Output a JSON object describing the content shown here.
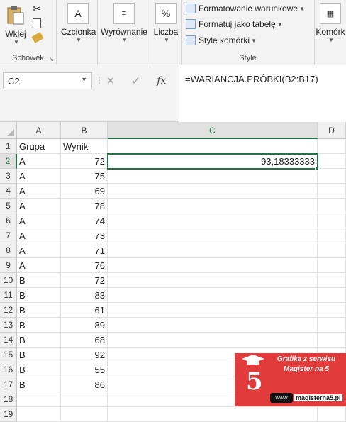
{
  "ribbon": {
    "clipboard": {
      "paste_label": "Wklej",
      "group_label": "Schowek"
    },
    "font": {
      "label": "Czcionka"
    },
    "alignment": {
      "label": "Wyrównanie"
    },
    "number": {
      "label": "Liczba",
      "icon_text": "%"
    },
    "styles": {
      "conditional_formatting": "Formatowanie warunkowe",
      "format_as_table": "Formatuj jako tabelę",
      "cell_styles": "Style komórki",
      "group_label": "Style"
    },
    "cells": {
      "label": "Komórk"
    }
  },
  "formula_bar": {
    "name_box": "C2",
    "cancel": "✕",
    "enter": "✓",
    "fx": "fx",
    "formula": "=WARIANCJA.PRÓBKI(B2:B17)"
  },
  "sheet": {
    "columns": [
      "A",
      "B",
      "C",
      "D"
    ],
    "rows": [
      {
        "n": "1",
        "a": "Grupa",
        "b": "Wynik",
        "c": ""
      },
      {
        "n": "2",
        "a": "A",
        "b": "72",
        "c": "93,18333333"
      },
      {
        "n": "3",
        "a": "A",
        "b": "75",
        "c": ""
      },
      {
        "n": "4",
        "a": "A",
        "b": "69",
        "c": ""
      },
      {
        "n": "5",
        "a": "A",
        "b": "78",
        "c": ""
      },
      {
        "n": "6",
        "a": "A",
        "b": "74",
        "c": ""
      },
      {
        "n": "7",
        "a": "A",
        "b": "73",
        "c": ""
      },
      {
        "n": "8",
        "a": "A",
        "b": "71",
        "c": ""
      },
      {
        "n": "9",
        "a": "A",
        "b": "76",
        "c": ""
      },
      {
        "n": "10",
        "a": "B",
        "b": "72",
        "c": ""
      },
      {
        "n": "11",
        "a": "B",
        "b": "83",
        "c": ""
      },
      {
        "n": "12",
        "a": "B",
        "b": "61",
        "c": ""
      },
      {
        "n": "13",
        "a": "B",
        "b": "89",
        "c": ""
      },
      {
        "n": "14",
        "a": "B",
        "b": "68",
        "c": ""
      },
      {
        "n": "15",
        "a": "B",
        "b": "92",
        "c": ""
      },
      {
        "n": "16",
        "a": "B",
        "b": "55",
        "c": ""
      },
      {
        "n": "17",
        "a": "B",
        "b": "86",
        "c": ""
      },
      {
        "n": "18",
        "a": "",
        "b": "",
        "c": ""
      },
      {
        "n": "19",
        "a": "",
        "b": "",
        "c": ""
      }
    ],
    "active_cell": "C2",
    "accent": "#217346"
  },
  "watermark": {
    "line1": "Grafika z serwisu",
    "line2": "Magister na 5",
    "logo_digit": "5",
    "www": "www",
    "url": "magisterna5.pl",
    "bg_color": "#e23b3b"
  }
}
